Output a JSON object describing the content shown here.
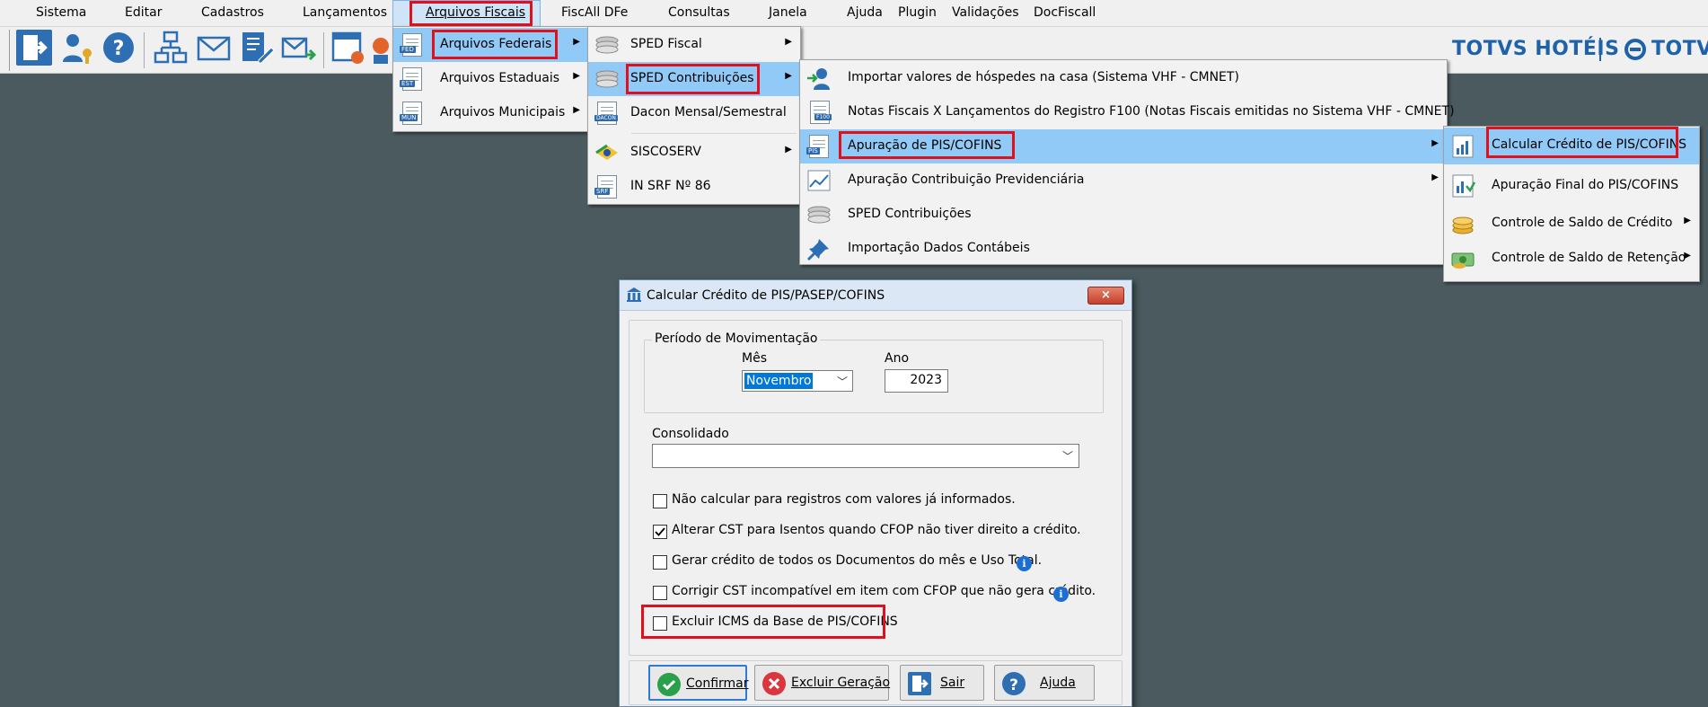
{
  "menubar": {
    "items": [
      "Sistema",
      "Editar",
      "Cadastros",
      "Lançamentos",
      "Arquivos Fiscais",
      "FiscAll DFe",
      "Consultas",
      "Janela",
      "Ajuda",
      "Plugin",
      "Validações",
      "DocFiscall"
    ]
  },
  "brand": {
    "product": "TOTVS HOTÉIS",
    "company": "TOTVS",
    "color": "#1e63a9"
  },
  "menu1": {
    "items": [
      {
        "label": "Arquivos Federais",
        "icon": "fed-document-icon",
        "tag": "FED"
      },
      {
        "label": "Arquivos Estaduais",
        "icon": "est-document-icon",
        "tag": "EST"
      },
      {
        "label": "Arquivos Municipais",
        "icon": "mun-document-icon",
        "tag": "MUN"
      }
    ]
  },
  "menu2": {
    "items": [
      {
        "label": "SPED Fiscal",
        "icon": "sped-stack-icon"
      },
      {
        "label": "SPED Contribuições",
        "icon": "sped-stack-icon"
      },
      {
        "label": "Dacon Mensal/Semestral",
        "icon": "dacon-document-icon",
        "tag": "DACON"
      },
      {
        "label": "SISCOSERV",
        "icon": "brazil-flag-icon"
      },
      {
        "label": "IN SRF Nº 86",
        "icon": "srf-document-icon",
        "tag": "SRF"
      }
    ]
  },
  "menu3": {
    "items": [
      {
        "label": "Importar valores de hóspedes na casa (Sistema VHF - CMNET)",
        "icon": "import-user-icon"
      },
      {
        "label": "Notas Fiscais X Lançamentos do Registro F100 (Notas Fiscais emitidas no Sistema VHF - CMNET)",
        "icon": "f100-document-icon",
        "tag": "F100"
      },
      {
        "label": "Apuração de PIS/COFINS",
        "icon": "pis-chart-icon",
        "tag": "PIS"
      },
      {
        "label": "Apuração Contribuição Previdenciária",
        "icon": "line-chart-icon"
      },
      {
        "label": "SPED Contribuições",
        "icon": "sped-stack-icon"
      },
      {
        "label": "Importação Dados Contábeis",
        "icon": "pin-icon"
      }
    ]
  },
  "menu4": {
    "items": [
      {
        "label": "Calcular Crédito de PIS/COFINS",
        "icon": "calc-credit-icon"
      },
      {
        "label": "Apuração Final do PIS/COFINS",
        "icon": "final-chart-icon"
      },
      {
        "label": "Controle de Saldo de Crédito",
        "icon": "coins-icon"
      },
      {
        "label": "Controle de Saldo de Retenção",
        "icon": "money-icon"
      }
    ]
  },
  "dialog": {
    "title": "Calcular Crédito de PIS/PASEP/COFINS",
    "close": "×",
    "periodo_legend": "Período de Movimentação",
    "mes_label": "Mês",
    "mes_value": "Novembro",
    "ano_label": "Ano",
    "ano_value": "2023",
    "consolidado_label": "Consolidado",
    "consolidado_value": "",
    "options": [
      {
        "label": "Não calcular para registros com valores já informados.",
        "checked": false
      },
      {
        "label": "Alterar CST para Isentos quando CFOP não tiver direito a crédito.",
        "checked": true
      },
      {
        "label": "Gerar crédito de todos os Documentos do mês e Uso Total.",
        "checked": false
      },
      {
        "label": "Corrigir CST incompatível em item com CFOP que não gera crédito.",
        "checked": false
      },
      {
        "label": "Excluir ICMS da Base de PIS/COFINS",
        "checked": false
      }
    ],
    "info_glyph": "i",
    "buttons": {
      "confirmar": "Confirmar",
      "excluir": "Excluir Geração",
      "sair": "Sair",
      "ajuda": "Ajuda"
    }
  },
  "colors": {
    "desktop": "#4b5a5e",
    "menu_highlight": "#91c9f7",
    "annotation_red": "#e0101c"
  }
}
